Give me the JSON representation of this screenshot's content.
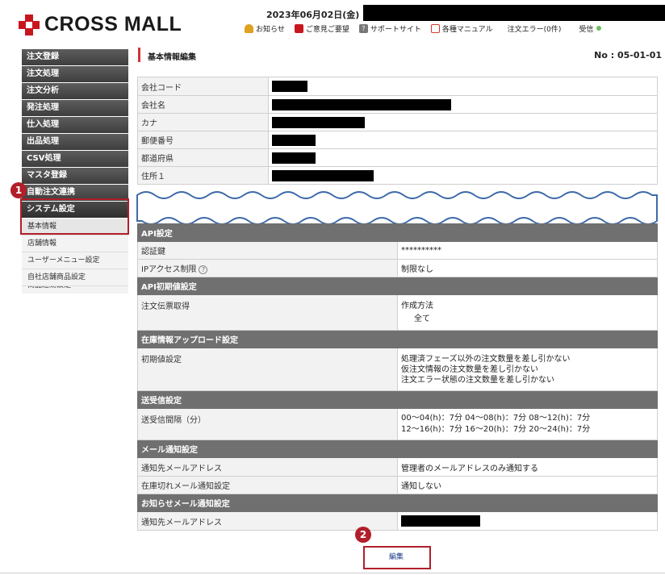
{
  "header": {
    "logo_text": "CROSS MALL",
    "date": "2023年06月02日(金)",
    "links": [
      {
        "label": "お知らせ",
        "icon": "bell-icon",
        "color": "#e0a020"
      },
      {
        "label": "ご意見ご要望",
        "icon": "mailbox-icon",
        "color": "#c8161d"
      },
      {
        "label": "サポートサイト",
        "icon": "help-icon",
        "color": "#777777"
      },
      {
        "label": "各種マニュアル",
        "icon": "pdf-icon",
        "color": "#d23a2e"
      },
      {
        "label": "注文エラー(0件)",
        "icon": "",
        "color": ""
      },
      {
        "label": "受信",
        "icon": "status-dot-icon",
        "color": "#6cbf5a"
      }
    ]
  },
  "sidebar": {
    "items": [
      "注文登録",
      "注文処理",
      "注文分析",
      "発注処理",
      "仕入処理",
      "出品処理",
      "CSV処理",
      "マスタ登録",
      "自動注文連携",
      "システム設定"
    ],
    "sub_items": [
      "基本情報",
      "店舗情報",
      "ユーザーメニュー設定",
      "自社店舗商品設定",
      "商品連動設定"
    ]
  },
  "annotations": {
    "one": "1",
    "two": "2"
  },
  "main": {
    "title": "基本情報編集",
    "page_no": "No : 05-01-01",
    "company_rows": [
      "会社コード",
      "会社名",
      "カナ",
      "郵便番号",
      "都道府県",
      "住所１"
    ],
    "api": {
      "section": "API設定",
      "auth_label": "認証鍵",
      "auth_value": "**********",
      "ip_label": "IPアクセス制限",
      "ip_help": "?",
      "ip_value": "制限なし"
    },
    "api_init": {
      "section": "API初期値設定",
      "label": "注文伝票取得",
      "value_line1": "作成方法",
      "value_line2": "全て"
    },
    "stock": {
      "section": "在庫情報アップロード設定",
      "label": "初期値設定",
      "lines": [
        "処理済フェーズ以外の注文数量を差し引かない",
        "仮注文情報の注文数量を差し引かない",
        "注文エラー状態の注文数量を差し引かない"
      ]
    },
    "sendrecv": {
      "section": "送受信設定",
      "label": "送受信間隔（分）",
      "line1": "00〜04(h)：7分 04〜08(h)：7分 08〜12(h)：7分",
      "line2": "12〜16(h)：7分 16〜20(h)：7分 20〜24(h)：7分"
    },
    "mail": {
      "section": "メール通知設定",
      "to_label": "通知先メールアドレス",
      "to_value": "管理者のメールアドレスのみ通知する",
      "stockout_label": "在庫切れメール通知設定",
      "stockout_value": "通知しない"
    },
    "notice_mail": {
      "section": "お知らせメール通知設定",
      "to_label": "通知先メールアドレス"
    },
    "edit_label": "編集"
  },
  "colors": {
    "brand": "#c8161d",
    "annotation": "#b11f2a",
    "wave": "#3d6aa8",
    "section": "#707070"
  }
}
